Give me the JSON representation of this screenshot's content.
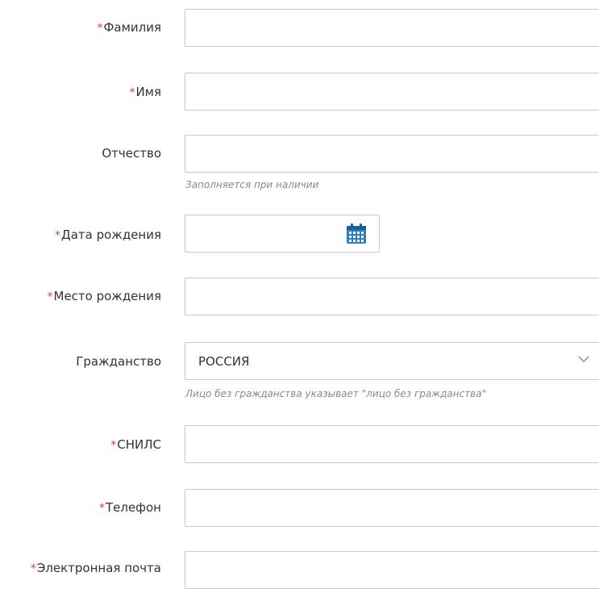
{
  "form": {
    "surname": {
      "label": "Фамилия",
      "required": true,
      "value": ""
    },
    "name": {
      "label": "Имя",
      "required": true,
      "value": ""
    },
    "patronymic": {
      "label": "Отчество",
      "required": false,
      "value": "",
      "hint": "Заполняется при наличии"
    },
    "birth_date": {
      "label": "Дата рождения",
      "required": true,
      "value": "",
      "icon": "calendar-icon"
    },
    "birth_place": {
      "label": "Место рождения",
      "required": true,
      "value": ""
    },
    "citizenship": {
      "label": "Гражданство",
      "required": false,
      "value": "РОССИЯ",
      "hint": "Лицо без гражданства указывает \"лицо без гражданства\"",
      "icon": "chevron-down-icon"
    },
    "snils": {
      "label": "СНИЛС",
      "required": true,
      "value": ""
    },
    "phone": {
      "label": "Телефон",
      "required": true,
      "value": ""
    },
    "email": {
      "label": "Электронная почта",
      "required": true,
      "value": ""
    }
  },
  "required_mark": "*",
  "colors": {
    "required_mark": "#e63946",
    "field_border": "#c7c7c7",
    "hint_text": "#8a8a8a",
    "calendar_icon": "#2f7fc1"
  }
}
